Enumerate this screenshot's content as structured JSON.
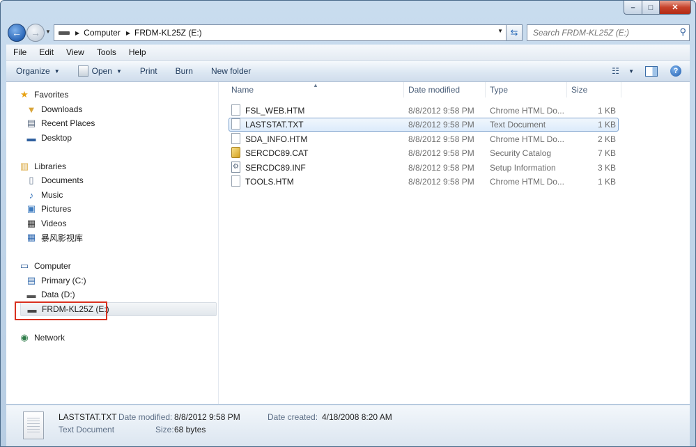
{
  "window": {
    "caption_buttons": {
      "minimize": "–",
      "maximize": "□",
      "close": "✕"
    }
  },
  "address": {
    "crumbs": [
      "Computer",
      "FRDM-KL25Z (E:)"
    ],
    "search_placeholder": "Search FRDM-KL25Z (E:)"
  },
  "menu": [
    "File",
    "Edit",
    "View",
    "Tools",
    "Help"
  ],
  "toolbar": {
    "organize": "Organize",
    "open": "Open",
    "print": "Print",
    "burn": "Burn",
    "new_folder": "New folder"
  },
  "nav": {
    "favorites": {
      "label": "Favorites",
      "items": [
        "Downloads",
        "Recent Places",
        "Desktop"
      ]
    },
    "libraries": {
      "label": "Libraries",
      "items": [
        "Documents",
        "Music",
        "Pictures",
        "Videos",
        "暴风影视库"
      ]
    },
    "computer": {
      "label": "Computer",
      "items": [
        "Primary (C:)",
        "Data (D:)",
        "FRDM-KL25Z (E:)"
      ]
    },
    "network": {
      "label": "Network"
    }
  },
  "columns": {
    "name": "Name",
    "date": "Date modified",
    "type": "Type",
    "size": "Size"
  },
  "files": [
    {
      "name": "FSL_WEB.HTM",
      "date": "8/8/2012 9:58 PM",
      "type": "Chrome HTML Do...",
      "size": "1 KB"
    },
    {
      "name": "LASTSTAT.TXT",
      "date": "8/8/2012 9:58 PM",
      "type": "Text Document",
      "size": "1 KB"
    },
    {
      "name": "SDA_INFO.HTM",
      "date": "8/8/2012 9:58 PM",
      "type": "Chrome HTML Do...",
      "size": "2 KB"
    },
    {
      "name": "SERCDC89.CAT",
      "date": "8/8/2012 9:58 PM",
      "type": "Security Catalog",
      "size": "7 KB"
    },
    {
      "name": "SERCDC89.INF",
      "date": "8/8/2012 9:58 PM",
      "type": "Setup Information",
      "size": "3 KB"
    },
    {
      "name": "TOOLS.HTM",
      "date": "8/8/2012 9:58 PM",
      "type": "Chrome HTML Do...",
      "size": "1 KB"
    }
  ],
  "details": {
    "filename": "LASTSTAT.TXT",
    "filetype": "Text Document",
    "date_modified_label": "Date modified:",
    "date_modified": "8/8/2012 9:58 PM",
    "size_label": "Size:",
    "size": "68 bytes",
    "date_created_label": "Date created:",
    "date_created": "4/18/2008 8:20 AM"
  }
}
